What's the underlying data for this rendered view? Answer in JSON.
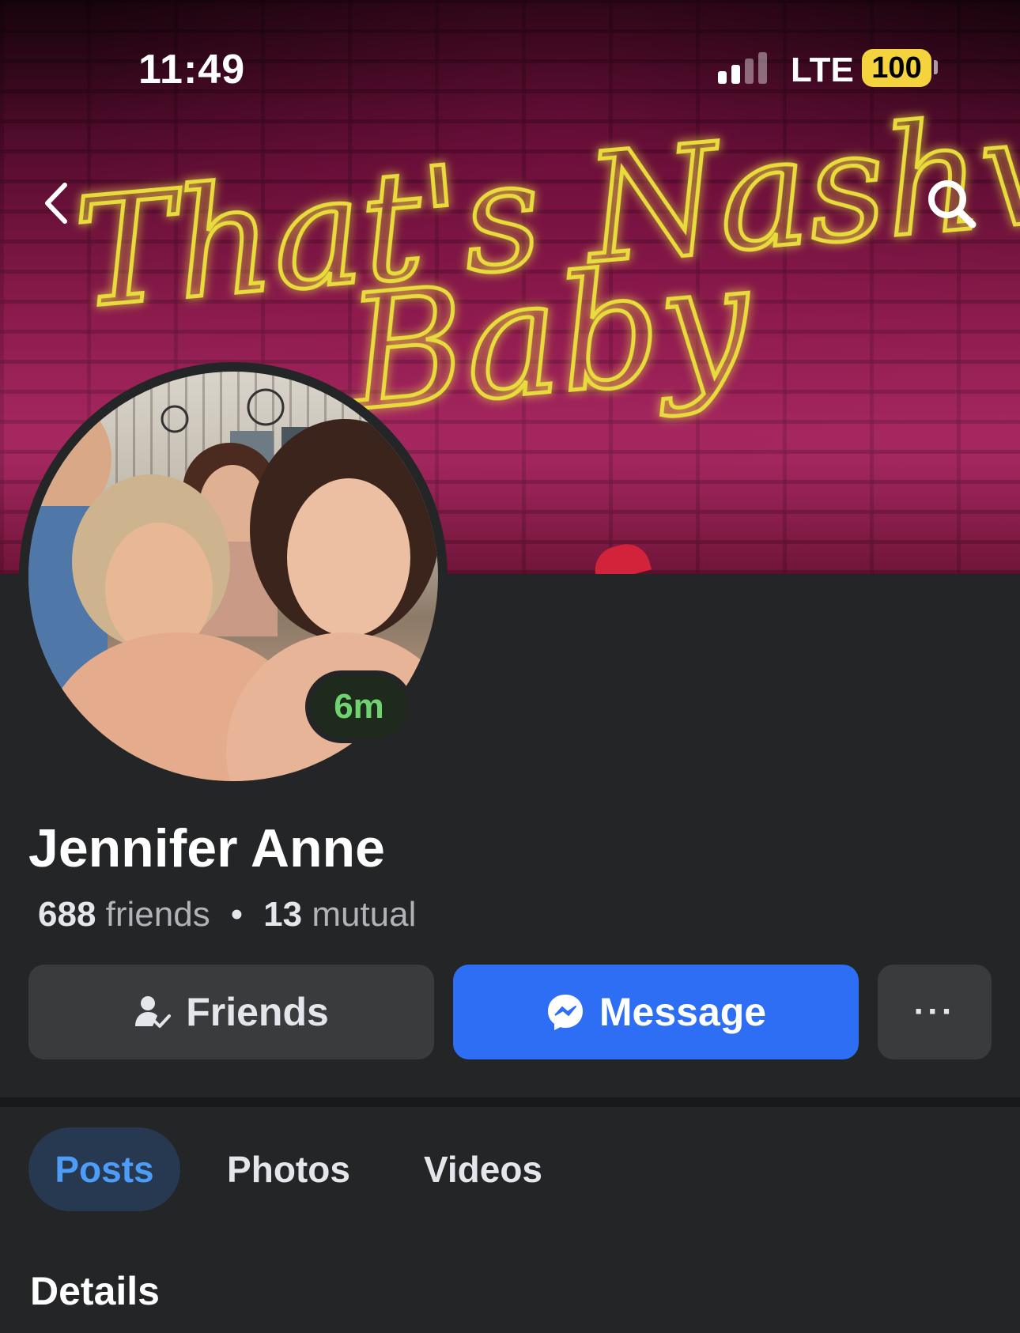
{
  "status_bar": {
    "time": "11:49",
    "network": "LTE",
    "battery": "100"
  },
  "header": {
    "back_icon": "chevron-left-icon",
    "search_icon": "search-icon"
  },
  "cover": {
    "sign_line1": "That's Nashville,",
    "sign_line2": "Baby",
    "neon_color": "#e8dc3c"
  },
  "profile": {
    "story_badge": "6m",
    "name": "Jennifer Anne",
    "friends_count": "688",
    "friends_label": "friends",
    "separator": "•",
    "mutual_count": "13",
    "mutual_label": "mutual"
  },
  "actions": {
    "friends_label": "Friends",
    "friends_icon": "friend-check-icon",
    "message_label": "Message",
    "message_icon": "messenger-icon",
    "more_label": "···"
  },
  "tabs": [
    {
      "label": "Posts",
      "active": true
    },
    {
      "label": "Photos",
      "active": false
    },
    {
      "label": "Videos",
      "active": false
    }
  ],
  "section": {
    "details_title": "Details"
  },
  "colors": {
    "background": "#242526",
    "message_blue": "#2d6ef5",
    "active_tab_bg": "#263951",
    "active_tab_text": "#4d9cf8",
    "story_green": "#6fd46f"
  }
}
